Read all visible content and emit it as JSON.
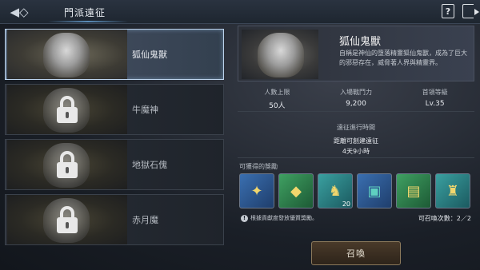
{
  "header": {
    "title": "門派遠征",
    "help_label": "?"
  },
  "expeditions": [
    {
      "name": "狐仙鬼獸",
      "locked": false
    },
    {
      "name": "牛魔神",
      "locked": true
    },
    {
      "name": "地獄石傀",
      "locked": true
    },
    {
      "name": "赤月魔",
      "locked": true
    }
  ],
  "selected": {
    "name": "狐仙鬼獸",
    "description": "自稱是神仙的墮落精靈狐仙鬼獸，成為了巨大的邪惡存在，威脅著人界與精靈界。",
    "stats": [
      {
        "label": "人數上限",
        "value": "50人"
      },
      {
        "label": "入場戰鬥力",
        "value": "9,200"
      },
      {
        "label": "首領等級",
        "value": "Lv.35"
      }
    ],
    "time_label": "遠征進行時間",
    "time_subtitle": "距離可創建遠征",
    "time_value": "4天9小時"
  },
  "rewards": {
    "label": "可獲得的獎勵",
    "items": [
      {
        "icon": "amulet-icon",
        "glyph": "✦",
        "color": "blue",
        "qty": ""
      },
      {
        "icon": "gold-box-icon",
        "glyph": "◆",
        "color": "green",
        "qty": ""
      },
      {
        "icon": "jade-dragon-icon",
        "glyph": "♞",
        "color": "teal",
        "qty": "20"
      },
      {
        "icon": "treasure-chest-icon",
        "glyph": "▣",
        "color": "blue",
        "qty": ""
      },
      {
        "icon": "wooden-chest-icon",
        "glyph": "▤",
        "color": "green",
        "qty": ""
      },
      {
        "icon": "jade-statue-icon",
        "glyph": "♜",
        "color": "teal",
        "qty": ""
      }
    ],
    "notice": "根據貢獻度發放優質獎勵。",
    "summon_count": "可召喚次數：2／2"
  },
  "summon_label": "召喚"
}
